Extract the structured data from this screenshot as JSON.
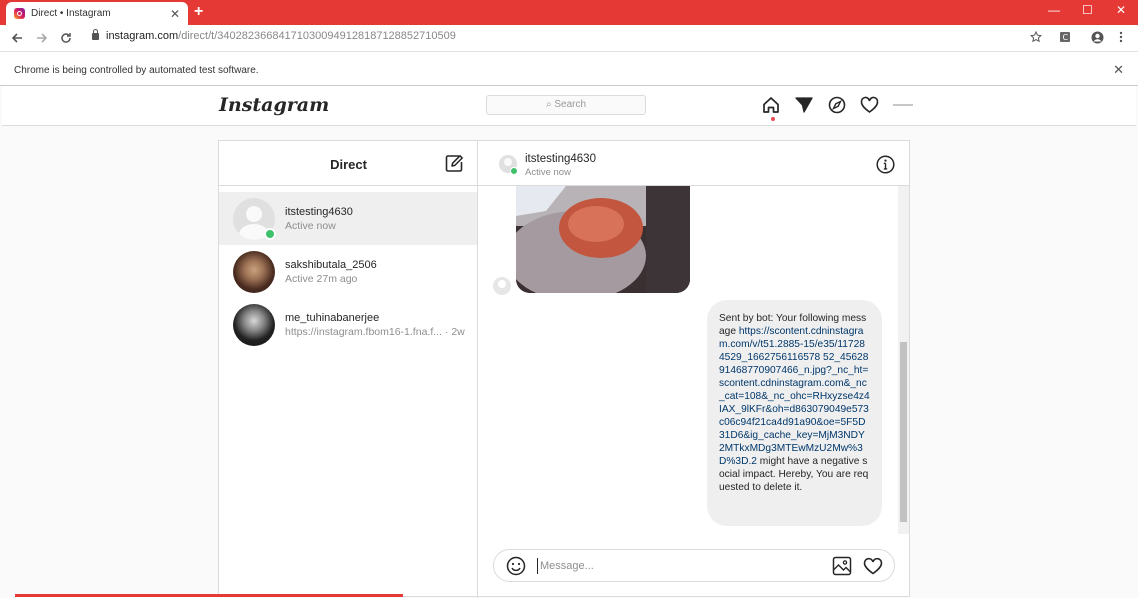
{
  "browser": {
    "tab_title": "Direct • Instagram",
    "tab_close": "✕",
    "new_tab": "+",
    "minimize": "—",
    "maximize": "☐",
    "close": "✕",
    "url_host": "instagram.com",
    "url_path": "/direct/t/340282366841710300949128187128852710509",
    "automation_notice": "Chrome is being controlled by automated test software.",
    "notice_close": "✕"
  },
  "instagram": {
    "logo": "Instagram",
    "search_placeholder": "Search",
    "nav_icons": [
      "home-icon",
      "direct-icon",
      "explore-icon",
      "activity-icon",
      "profile-icon"
    ]
  },
  "inbox": {
    "title": "Direct",
    "threads": [
      {
        "name": "itstesting4630",
        "sub": "Active now",
        "online": true
      },
      {
        "name": "sakshibutala_2506",
        "sub": "Active 27m ago",
        "online": false
      },
      {
        "name": "me_tuhinabanerjee",
        "sub": "https://instagram.fbom16-1.fna.f... · 2w",
        "online": false
      }
    ]
  },
  "conversation": {
    "username": "itstesting4630",
    "status": "Active now",
    "message": {
      "prefix": "Sent by bot: Your following message ",
      "link": "https://scontent.cdninstagram.com/v/t51.2885-15/e35/117284529_1662756116578 52_4562891468770907466_n.jpg?_nc_ht=scontent.cdninstagram.com&_nc_cat=108&_nc_ohc=RHxyzse4z4IAX_9lKFr&oh=d863079049e573c06c94f21ca4d91a90&oe=5F5D31D6&ig_cache_key=MjM3NDY2MTkxMDg3MTEwMzU2Mw%3D%3D.2",
      "suffix": " might have a negative social impact. Hereby, You are requested to delete it."
    },
    "composer_placeholder": "Message..."
  },
  "colors": {
    "chrome_red": "#e53935",
    "online_green": "#3ec16a",
    "link": "#00376b"
  }
}
